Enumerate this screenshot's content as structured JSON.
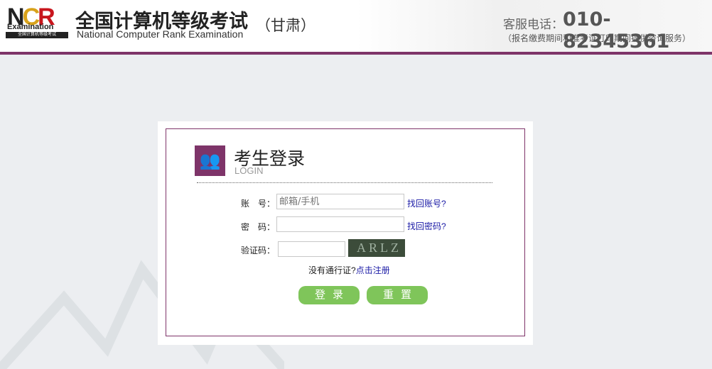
{
  "header": {
    "logo_text": "NCR",
    "logo_sub": "Examination",
    "logo_cn": "全国计算机等级考试",
    "title_cn": "全国计算机等级考试",
    "title_en": "National Computer Rank Examination",
    "province": "（甘肃）",
    "phone_label": "客服电话：",
    "phone": "010-82345361",
    "hours": "（报名缴费期间和准考证打印期间提供咨询服务）"
  },
  "login": {
    "title": "考生登录",
    "subtitle": "LOGIN",
    "account_label": "账　号：",
    "account_placeholder": "邮箱/手机",
    "account_value": "",
    "find_account": "找回账号?",
    "password_label": "密　码：",
    "password_value": "",
    "find_password": "找回密码?",
    "captcha_label": "验证码：",
    "captcha_value": "",
    "captcha_text": "ARLZ",
    "no_pass": "没有通行证?",
    "register": "点击注册",
    "login_button": "登录",
    "reset_button": "重置"
  },
  "colors": {
    "brand": "#7e3469",
    "button": "#7fc55a",
    "link": "#1a1aa6"
  }
}
